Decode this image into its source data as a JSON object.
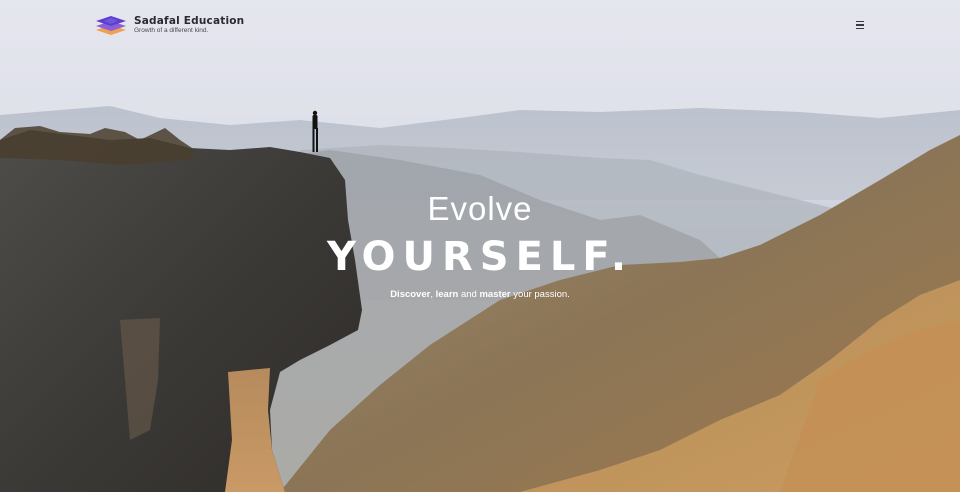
{
  "brand": {
    "name": "Sadafal Education",
    "tagline": "Growth of a different kind."
  },
  "nav": {
    "menu_icon": "hamburger-menu-icon"
  },
  "hero": {
    "title_line1": "Evolve",
    "title_line2": "YOURSELF.",
    "subtitle": {
      "word1": "Discover",
      "sep1": ", ",
      "word2": "learn",
      "sep2": " and ",
      "word3": "master",
      "rest": " your passion."
    },
    "background_image": "cliff-mountains-landscape"
  },
  "colors": {
    "logo_top": "#5a3fd0",
    "logo_middle": "#8a5fd8",
    "logo_bottom": "#f0a050",
    "text_dark": "#2a2a33",
    "hero_text": "#ffffff"
  }
}
